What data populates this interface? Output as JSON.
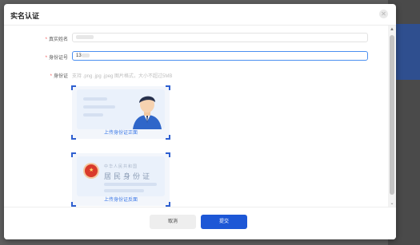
{
  "dialog": {
    "title": "实名认证",
    "close_icon": "close-icon"
  },
  "form": {
    "name": {
      "required_mark": "*",
      "label": "真实姓名",
      "value": ""
    },
    "idnumber": {
      "required_mark": "*",
      "label": "身份证号",
      "value": "13"
    },
    "idcard": {
      "required_mark": "*",
      "label": "身份证",
      "hint": "支持 .png .jpg .jpeg 图片格式，大小不超过5MB"
    }
  },
  "uploads": {
    "front": {
      "caption": "上传身份证正面",
      "icon": "id-card-front-illustration"
    },
    "back": {
      "caption": "上传身份证反面",
      "country": "中华人民共和国",
      "card_title": "居民身份证",
      "icon": "id-card-back-illustration"
    }
  },
  "footer": {
    "cancel_label": "取消",
    "submit_label": "提交"
  },
  "colors": {
    "primary": "#1d57d6",
    "accent_blue": "#3b78e7",
    "required": "#f25555",
    "focus_border": "#4b8ff0"
  }
}
